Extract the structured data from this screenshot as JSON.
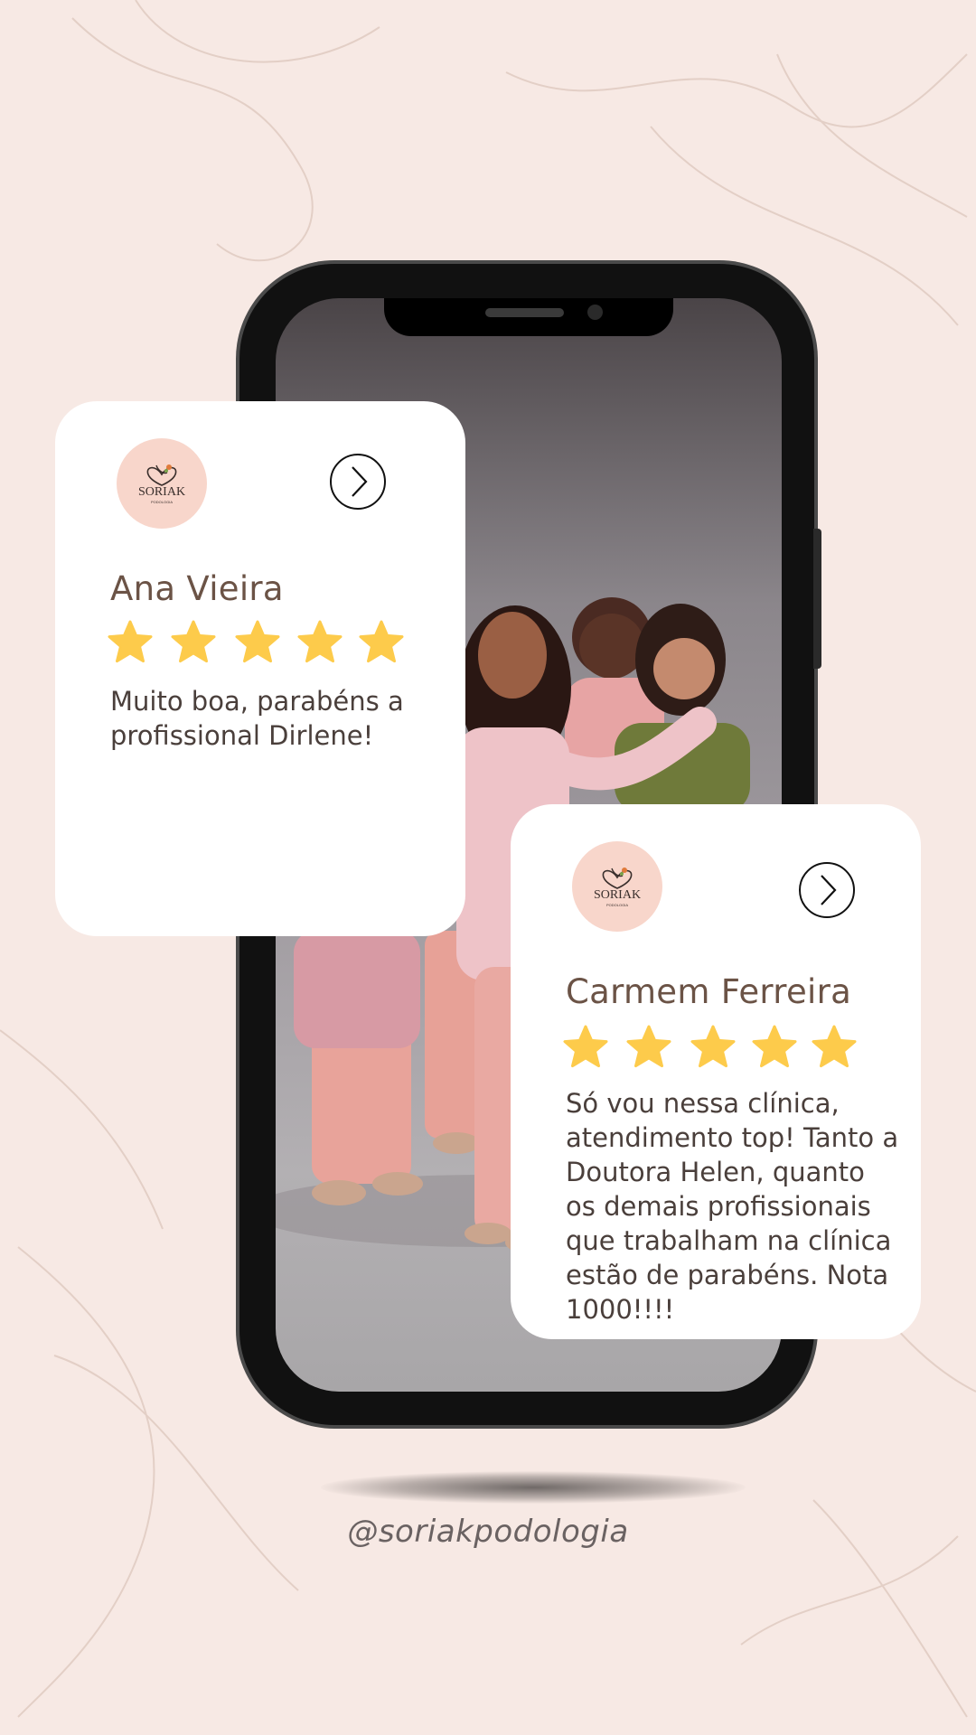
{
  "brand": {
    "logo_text": "SORIAK",
    "logo_subtext": "PODOLOGIA",
    "handle": "@soriakpodologia"
  },
  "colors": {
    "background": "#f7e9e4",
    "logo_circle": "#f8d6cb",
    "name_color": "#6b5346",
    "star_color": "#fdcb4b"
  },
  "icons": {
    "next": "chevron-right-icon",
    "rating": "star-icon"
  },
  "reviews": [
    {
      "name": "Ana Vieira",
      "rating": 5,
      "text": "Muito boa, parabéns a profissional Dirlene!"
    },
    {
      "name": "Carmem Ferreira",
      "rating": 5,
      "text": "Só vou nessa clínica, atendimento top! Tanto a Doutora Helen, quanto os demais profissionais que trabalham na clínica estão de parabéns. Nota 1000!!!!"
    }
  ]
}
